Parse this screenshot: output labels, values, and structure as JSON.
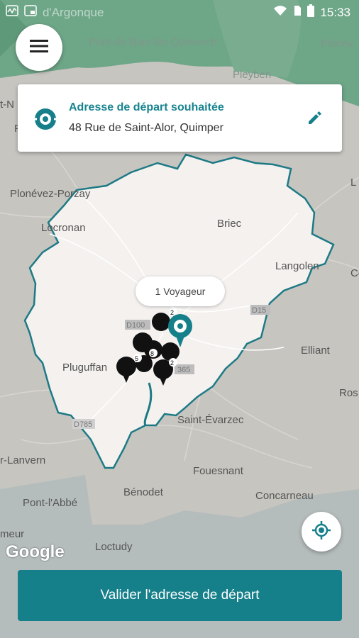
{
  "status_bar": {
    "time": "15:33",
    "faded_label": "d'Argonque"
  },
  "menu": {
    "icon": "hamburger-menu-icon"
  },
  "address_card": {
    "title": "Adresse de départ souhaitée",
    "address": "48 Rue de Saint-Alor, Quimper",
    "icons": [
      "location-target-icon",
      "pencil-edit-icon"
    ]
  },
  "map": {
    "places": [
      "Pont-de-Buis-lès-Quimerch",
      "Plonév",
      "Pleyben",
      "Plonévez-Porzay",
      "Locronan",
      "Briec",
      "Langolen",
      "Elliant",
      "Pluguffan",
      "Saint-Évarzec",
      "r-Lanvern",
      "Fouesnant",
      "Bénodet",
      "Concarneau",
      "Pont-l'Abbé",
      "Loctudy",
      "meur",
      "Ros",
      "Co",
      "t-N",
      "F",
      "L"
    ],
    "roads": [
      "D100",
      "D15",
      "D785",
      "365"
    ],
    "marker_counts": [
      "2",
      "8",
      "5",
      "2"
    ],
    "voyageur_label": "1 Voyageur",
    "attribution": "Google"
  },
  "actions": {
    "locate_icon": "my-location-icon",
    "validate_label": "Valider l'adresse de départ"
  },
  "colors": {
    "accent": "#157f8a",
    "service_zone": "#f4f1ef",
    "zone_border": "#1d7a85",
    "outer_green": "#6ea688"
  }
}
